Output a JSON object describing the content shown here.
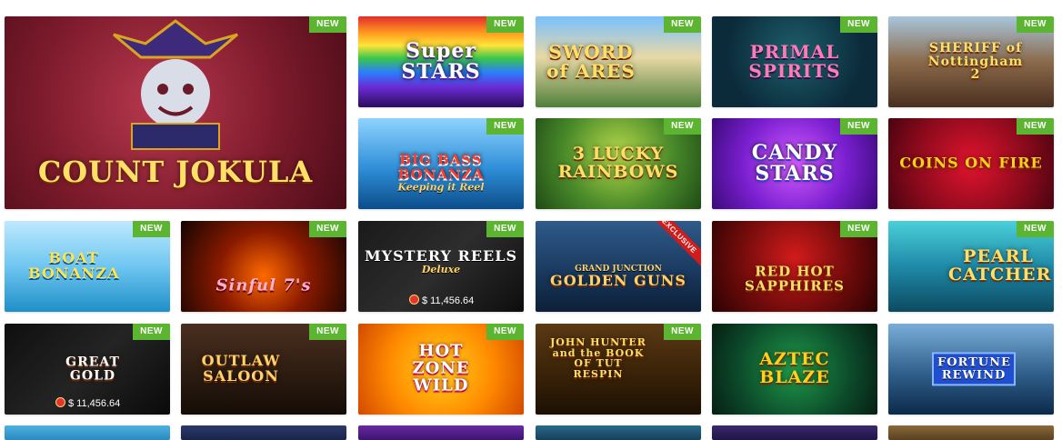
{
  "badges": {
    "new": "NEW",
    "exclusive": "EXCLUSIVE"
  },
  "jackpot_amount": "$ 11,456.64",
  "games": [
    {
      "title": "COUNT JOKULA",
      "subtitle": "",
      "badge": "NEW",
      "jackpot": ""
    },
    {
      "title": "Super STARS",
      "subtitle": "",
      "badge": "NEW",
      "jackpot": ""
    },
    {
      "title": "SWORD of ARES",
      "subtitle": "",
      "badge": "NEW",
      "jackpot": ""
    },
    {
      "title": "PRIMAL SPIRITS",
      "subtitle": "",
      "badge": "NEW",
      "jackpot": ""
    },
    {
      "title": "SHERIFF of Nottingham 2",
      "subtitle": "",
      "badge": "NEW",
      "jackpot": ""
    },
    {
      "title": "BIG BASS BONANZA",
      "subtitle": "Keeping it Reel",
      "badge": "NEW",
      "jackpot": ""
    },
    {
      "title": "3 LUCKY RAINBOWS",
      "subtitle": "",
      "badge": "NEW",
      "jackpot": ""
    },
    {
      "title": "CANDY STARS",
      "subtitle": "",
      "badge": "NEW",
      "jackpot": ""
    },
    {
      "title": "COINS ON FIRE",
      "subtitle": "",
      "badge": "NEW",
      "jackpot": ""
    },
    {
      "title": "BOAT BONANZA",
      "subtitle": "",
      "badge": "NEW",
      "jackpot": ""
    },
    {
      "title": "Sinful 7's",
      "subtitle": "",
      "badge": "NEW",
      "jackpot": ""
    },
    {
      "title": "MYSTERY REELS",
      "subtitle": "Deluxe",
      "badge": "NEW",
      "jackpot": "$ 11,456.64"
    },
    {
      "title": "GOLDEN GUNS",
      "subtitle": "GRAND JUNCTION",
      "badge": "EXCLUSIVE",
      "jackpot": ""
    },
    {
      "title": "RED HOT SAPPHIRES",
      "subtitle": "",
      "badge": "NEW",
      "jackpot": ""
    },
    {
      "title": "PEARL CATCHER",
      "subtitle": "",
      "badge": "NEW",
      "jackpot": ""
    },
    {
      "title": "GREAT GOLD",
      "subtitle": "",
      "badge": "NEW",
      "jackpot": "$ 11,456.64"
    },
    {
      "title": "OUTLAW SALOON",
      "subtitle": "",
      "badge": "NEW",
      "jackpot": ""
    },
    {
      "title": "HOT ZONE WILD",
      "subtitle": "",
      "badge": "NEW",
      "jackpot": ""
    },
    {
      "title": "JOHN HUNTER and the BOOK OF TUT RESPIN",
      "subtitle": "",
      "badge": "NEW",
      "jackpot": ""
    },
    {
      "title": "AZTEC BLAZE",
      "subtitle": "",
      "badge": "",
      "jackpot": ""
    },
    {
      "title": "FORTUNE REWIND",
      "subtitle": "",
      "badge": "",
      "jackpot": ""
    }
  ],
  "colors": {
    "new_badge": "#5cb531",
    "exclusive_badge": "#d21b1b",
    "title_gold": "#ffe066"
  }
}
